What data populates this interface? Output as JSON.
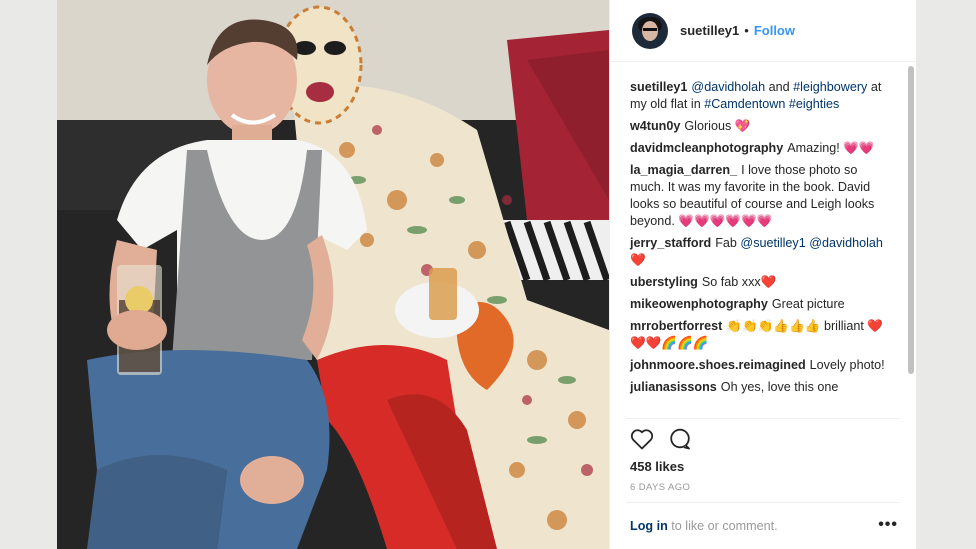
{
  "header": {
    "username": "suetilley1",
    "separator": "•",
    "follow_label": "Follow"
  },
  "comments": [
    {
      "user": "suetilley1",
      "parts": [
        {
          "t": "@davidholah",
          "link": true
        },
        {
          "t": " and ",
          "link": false
        },
        {
          "t": "#leighbowery",
          "link": true
        },
        {
          "t": " at my old flat in ",
          "link": false
        },
        {
          "t": "#Camdentown",
          "link": true
        },
        {
          "t": " ",
          "link": false
        },
        {
          "t": "#eighties",
          "link": true
        }
      ]
    },
    {
      "user": "w4tun0y",
      "parts": [
        {
          "t": "Glorious 💖",
          "link": false
        }
      ]
    },
    {
      "user": "davidmcleanphotography",
      "parts": [
        {
          "t": "Amazing! 💗💗",
          "link": false
        }
      ]
    },
    {
      "user": "la_magia_darren_",
      "parts": [
        {
          "t": "I love those photo so much. It was my favorite in the book. David looks so beautiful of course and Leigh looks beyond. 💗💗💗💗💗💗",
          "link": false
        }
      ]
    },
    {
      "user": "jerry_stafford",
      "parts": [
        {
          "t": "Fab ",
          "link": false
        },
        {
          "t": "@suetilley1",
          "link": true
        },
        {
          "t": " ",
          "link": false
        },
        {
          "t": "@davidholah",
          "link": true
        },
        {
          "t": " ❤️",
          "link": false
        }
      ]
    },
    {
      "user": "uberstyling",
      "parts": [
        {
          "t": "So fab xxx❤️",
          "link": false
        }
      ]
    },
    {
      "user": "mikeowenphotography",
      "parts": [
        {
          "t": "Great picture",
          "link": false
        }
      ]
    },
    {
      "user": "mrrobertforrest",
      "parts": [
        {
          "t": "👏👏👏👍👍👍 brilliant ❤️❤️❤️🌈🌈🌈",
          "link": false
        }
      ]
    },
    {
      "user": "johnmoore.shoes.reimagined",
      "parts": [
        {
          "t": "Lovely photo!",
          "link": false
        }
      ]
    },
    {
      "user": "julianasissons",
      "parts": [
        {
          "t": "Oh yes, love this one",
          "link": false
        }
      ]
    }
  ],
  "actions": {
    "like_icon": "heart-outline-icon",
    "comment_icon": "comment-bubble-icon"
  },
  "likes": "458 likes",
  "timestamp": "6 DAYS AGO",
  "footer": {
    "login_link": "Log in",
    "login_text": " to like or comment.",
    "more_icon": "more-options-icon",
    "more_symbol": "•••"
  },
  "colors": {
    "link": "#003569",
    "follow": "#3897f0",
    "muted": "#999999",
    "scrollbar": "#c1c1c1"
  }
}
